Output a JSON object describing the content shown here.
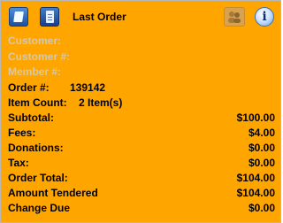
{
  "header": {
    "title": "Last Order",
    "buttons": [
      "print-icon",
      "receipt-icon",
      "customers-icon",
      "info-icon"
    ]
  },
  "customer": {
    "customer_label": "Customer:",
    "customer_num_label": "Customer #:",
    "member_num_label": "Member #:"
  },
  "order": {
    "order_num_label": "Order #:",
    "order_num": "139142",
    "item_count_label": "Item Count:",
    "item_count": "2 Item(s)"
  },
  "totals": [
    {
      "label": "Subtotal:",
      "value": "$100.00"
    },
    {
      "label": "Fees:",
      "value": "$4.00"
    },
    {
      "label": "Donations:",
      "value": "$0.00"
    },
    {
      "label": "Tax:",
      "value": "$0.00"
    },
    {
      "label": "Order Total:",
      "value": "$104.00"
    },
    {
      "label": "Amount Tendered",
      "value": "$104.00"
    },
    {
      "label": "Change Due",
      "value": "$0.00"
    }
  ],
  "colors": {
    "panel_bg": "#ffa500",
    "muted_text": "#d7c8a6",
    "text": "#000000"
  }
}
